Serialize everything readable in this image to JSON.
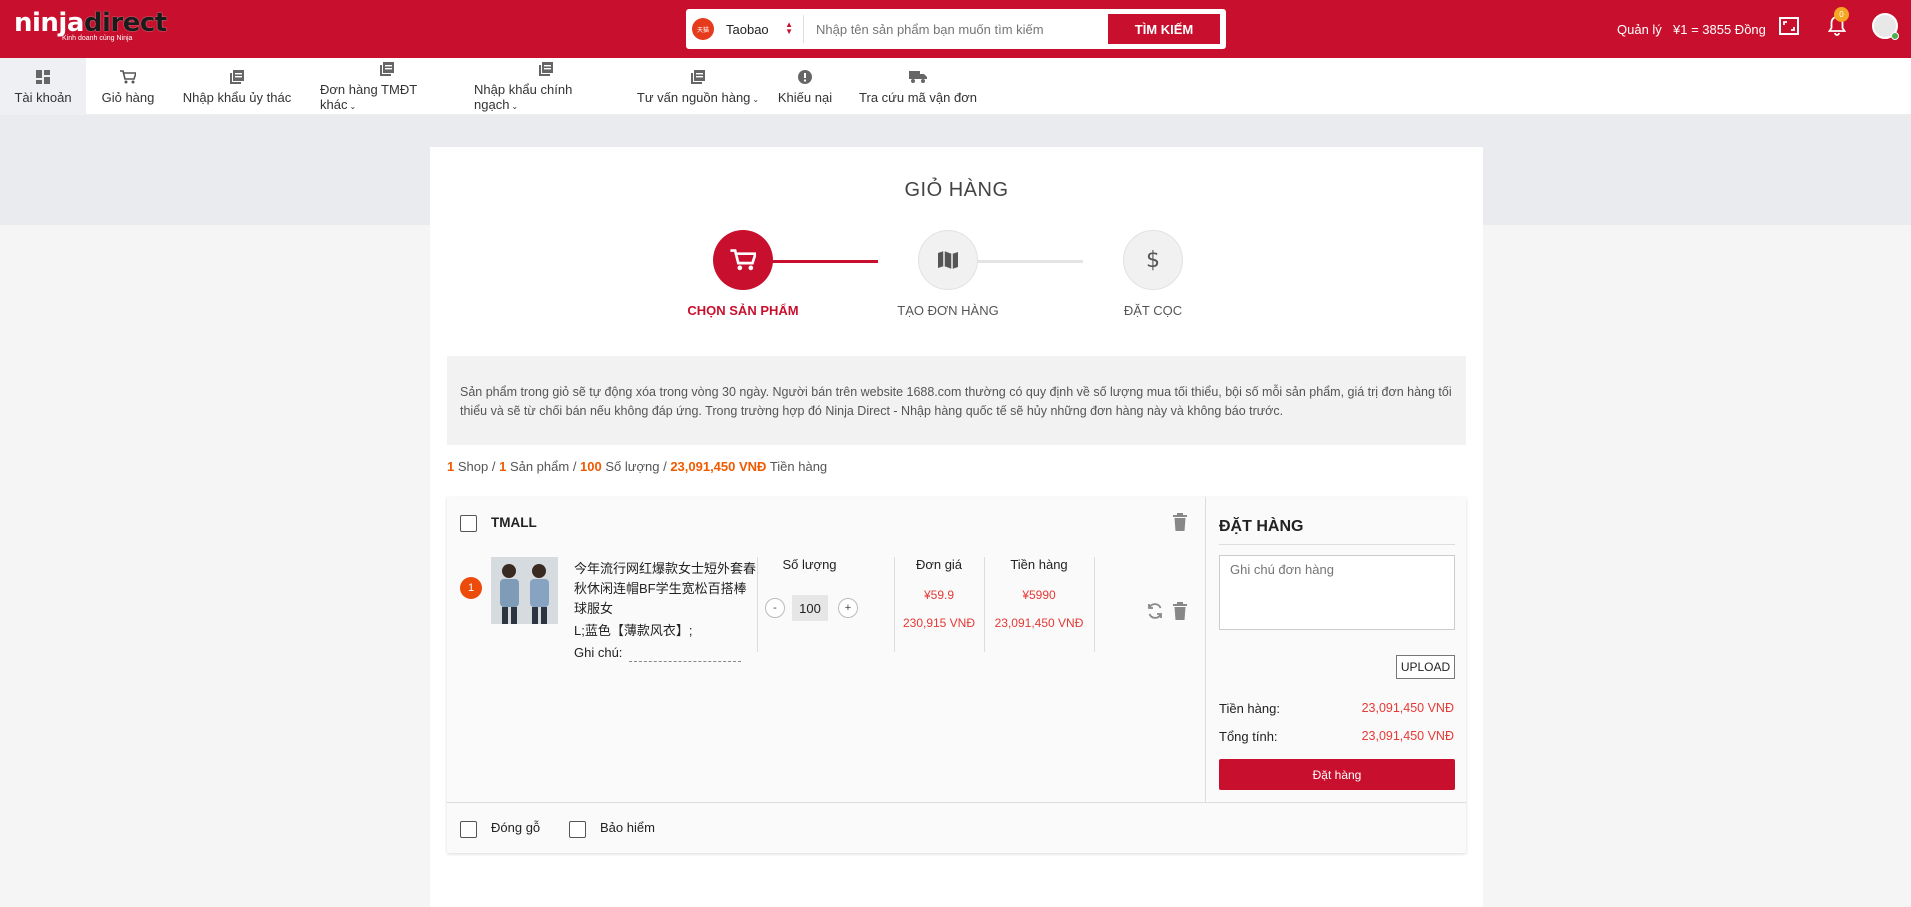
{
  "header": {
    "logo_text_a": "ninja",
    "logo_text_b": "direct",
    "logo_tagline": "Kinh doanh cùng Ninja",
    "source_select": {
      "value": "Taobao",
      "logo_label": "天猫"
    },
    "search": {
      "placeholder": "Nhập tên sản phẩm bạn muốn tìm kiếm",
      "button_label": "TÌM KIẾM"
    },
    "manage_label": "Quản lý",
    "exchange_rate": "¥1 = 3855 Đồng",
    "notification_count": "0"
  },
  "nav": {
    "items": [
      {
        "label": "Tài khoản",
        "icon": "dashboard-icon",
        "active": true
      },
      {
        "label": "Giỏ hàng",
        "icon": "cart-icon"
      },
      {
        "label": "Nhập khẩu ủy thác",
        "icon": "document-icon"
      },
      {
        "label": "Đơn hàng TMĐT khác",
        "icon": "document-icon",
        "dropdown": true
      },
      {
        "label": "Nhập khẩu chính ngạch",
        "icon": "document-icon",
        "dropdown": true
      },
      {
        "label": "Tư vấn nguồn hàng",
        "icon": "document-icon",
        "dropdown": true
      },
      {
        "label": "Khiếu nại",
        "icon": "alert-icon"
      },
      {
        "label": "Tra cứu mã vận đơn",
        "icon": "truck-icon"
      }
    ]
  },
  "page": {
    "title": "GIỎ HÀNG",
    "steps": [
      {
        "label": "CHỌN SẢN PHẨM",
        "icon": "cart-icon",
        "active": true
      },
      {
        "label": "TẠO ĐƠN HÀNG",
        "icon": "map-icon",
        "active": false
      },
      {
        "label": "ĐẶT CỌC",
        "icon": "dollar-icon",
        "active": false
      }
    ],
    "notice": "Sản phẩm trong giỏ sẽ tự động xóa trong vòng 30 ngày. Người bán trên website 1688.com thường có quy định về số lượng mua tối thiểu, bội số mỗi sản phẩm, giá trị đơn hàng tối thiểu và sẽ từ chối bán nếu không đáp ứng. Trong trường hợp đó Ninja Direct - Nhập hàng quốc tế sẽ hủy những đơn hàng này và không báo trước.",
    "summary": {
      "shops": "1",
      "shops_label": "Shop",
      "products": "1",
      "products_label": "Sản phẩm",
      "quantity": "100",
      "quantity_label": "Số lượng",
      "total": "23,091,450 VNĐ",
      "total_label": "Tiền hàng"
    }
  },
  "cart": {
    "shop_name": "TMALL",
    "columns": {
      "qty": "Số lượng",
      "unit_price": "Đơn giá",
      "amount": "Tiền hàng"
    },
    "item": {
      "index": "1",
      "name": "今年流行网红爆款女士短外套春秋休闲连帽BF学生宽松百搭棒球服女",
      "variant": "L;蓝色【薄款风衣】;",
      "note_label": "Ghi chú:",
      "qty": "100",
      "minus": "-",
      "plus": "+",
      "unit_price_cny": "¥59.9",
      "unit_price_vnd": "230,915 VNĐ",
      "amount_cny": "¥5990",
      "amount_vnd": "23,091,450 VNĐ"
    },
    "options": {
      "wood_packing": "Đóng gỗ",
      "insurance": "Bảo hiểm"
    }
  },
  "order_panel": {
    "title": "ĐẶT HÀNG",
    "note_placeholder": "Ghi chú đơn hàng",
    "upload_label": "UPLOAD",
    "goods_label": "Tiền hàng:",
    "goods_value": "23,091,450 VNĐ",
    "total_label": "Tổng tính:",
    "total_value": "23,091,450 VNĐ",
    "order_button": "Đặt hàng"
  },
  "colors": {
    "brand": "#c8102e",
    "price": "#e53935",
    "badge": "#ec4b0a"
  }
}
